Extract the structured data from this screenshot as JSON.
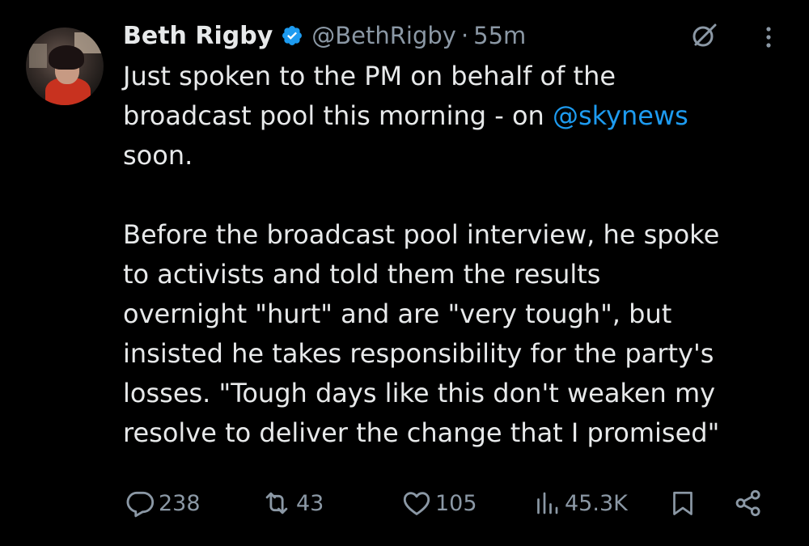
{
  "tweet": {
    "author_name": "Beth Rigby",
    "handle": "@BethRigby",
    "separator": "·",
    "time": "55m",
    "text_1a": "Just spoken to the PM on behalf of the",
    "text_1b_pre": "broadcast pool this morning - on ",
    "mention": "@skynews",
    "text_1c": "soon.",
    "text_2a": "Before the broadcast pool interview, he spoke",
    "text_2b": "to activists and told them the results",
    "text_2c": "overnight \"hurt\" and are \"very tough\", but",
    "text_2d": "insisted he takes responsibility for the party's",
    "text_2e": "losses. \"Tough days like this don't weaken my",
    "text_2f": "resolve to deliver the change that I promised\""
  },
  "actions": {
    "replies": "238",
    "reposts": "43",
    "likes": "105",
    "views": "45.3K"
  },
  "icons": [
    "verified-badge-icon",
    "grok-icon",
    "more-icon",
    "reply-icon",
    "repost-icon",
    "like-icon",
    "views-icon",
    "bookmark-icon",
    "share-icon"
  ],
  "colors": {
    "background": "#000000",
    "text": "#e7e9ea",
    "secondary": "#8b98a5",
    "link": "#1d9bf0"
  }
}
